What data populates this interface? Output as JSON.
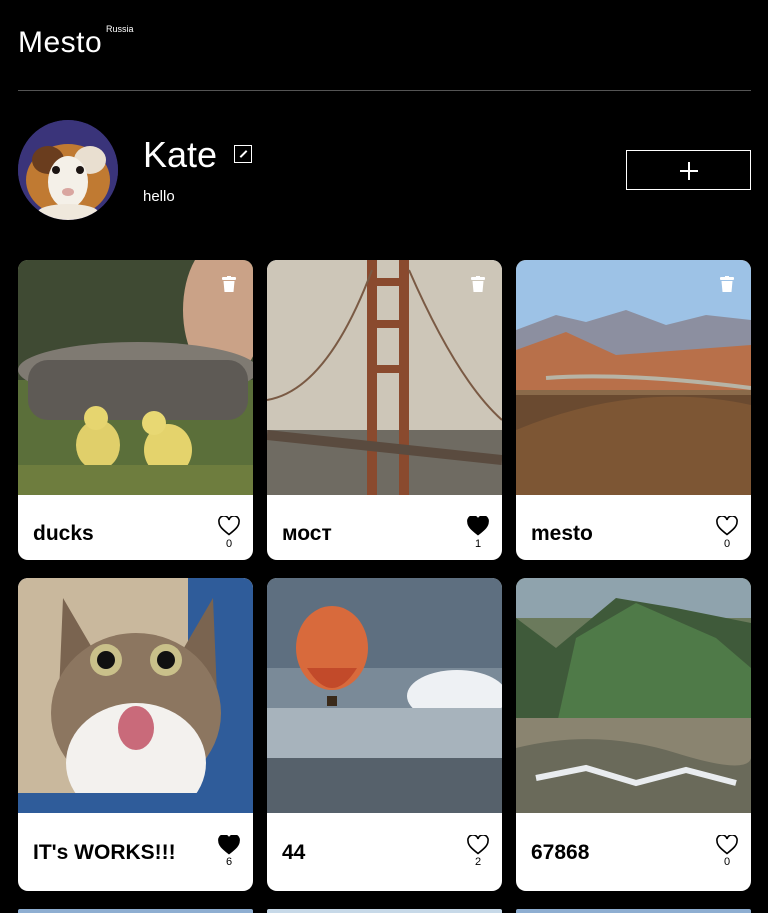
{
  "header": {
    "logo": "Mesto",
    "logo_sub": "Russia"
  },
  "profile": {
    "name": "Kate",
    "about": "hello",
    "avatar_icon": "guinea-pig-avatar",
    "edit_icon": "pencil-icon",
    "add_icon": "plus-icon"
  },
  "cards": [
    {
      "title": "ducks",
      "likes": "0",
      "liked": false,
      "photo": "ducks-photo",
      "can_delete": true
    },
    {
      "title": "мост",
      "likes": "1",
      "liked": true,
      "photo": "bridge-photo",
      "can_delete": true
    },
    {
      "title": "mesto",
      "likes": "0",
      "liked": false,
      "photo": "valley-photo",
      "can_delete": true
    },
    {
      "title": "IT's WORKS!!!",
      "likes": "6",
      "liked": true,
      "photo": "cat-photo",
      "can_delete": false
    },
    {
      "title": "44",
      "likes": "2",
      "liked": false,
      "photo": "balloon-photo",
      "can_delete": false
    },
    {
      "title": "67868",
      "likes": "0",
      "liked": false,
      "photo": "mountains-photo",
      "can_delete": false
    }
  ],
  "colors": {
    "background": "#000000",
    "card": "#ffffff",
    "divider": "#545454"
  }
}
